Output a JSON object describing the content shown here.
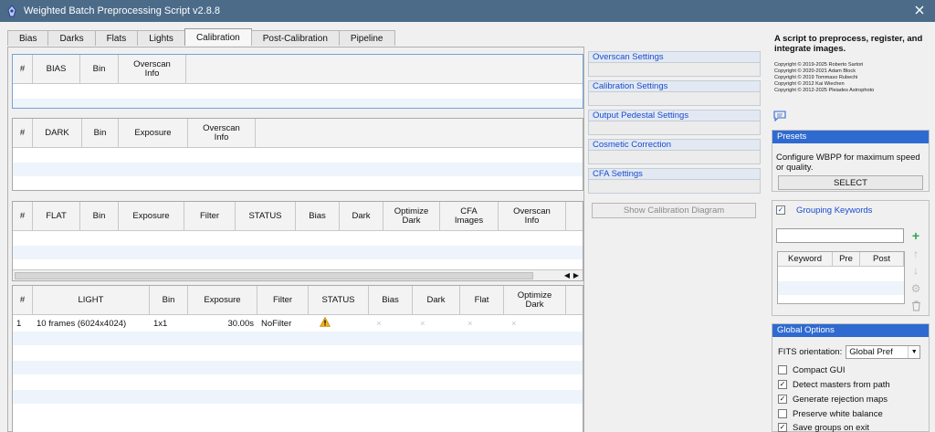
{
  "window": {
    "title": "Weighted Batch Preprocessing Script v2.8.8"
  },
  "tabs": [
    "Bias",
    "Darks",
    "Flats",
    "Lights",
    "Calibration",
    "Post-Calibration",
    "Pipeline"
  ],
  "active_tab": "Calibration",
  "bias_table": {
    "headers": [
      "#",
      "BIAS",
      "Bin",
      "Overscan\nInfo"
    ]
  },
  "dark_table": {
    "headers": [
      "#",
      "DARK",
      "Bin",
      "Exposure",
      "Overscan\nInfo"
    ]
  },
  "flat_table": {
    "headers": [
      "#",
      "FLAT",
      "Bin",
      "Exposure",
      "Filter",
      "STATUS",
      "Bias",
      "Dark",
      "Optimize\nDark",
      "CFA\nImages",
      "Overscan\nInfo"
    ]
  },
  "light_table": {
    "headers": [
      "#",
      "LIGHT",
      "Bin",
      "Exposure",
      "Filter",
      "STATUS",
      "Bias",
      "Dark",
      "Flat",
      "Optimize\nDark"
    ],
    "rows": [
      {
        "num": "1",
        "name": "10 frames (6024x4024)",
        "bin": "1x1",
        "exposure": "30.00s",
        "filter": "NoFilter",
        "status": "warning",
        "bias": "×",
        "dark": "×",
        "flat": "×",
        "optimize": "×"
      }
    ]
  },
  "settings_sections": [
    "Overscan Settings",
    "Calibration Settings",
    "Output Pedestal Settings",
    "Cosmetic Correction",
    "CFA Settings"
  ],
  "diagram_button": "Show Calibration Diagram",
  "description": "A script to preprocess, register, and integrate images.",
  "copyright": [
    "Copyright © 2019-2025 Roberto Sartori",
    "Copyright © 2020-2021 Adam Block",
    "Copyright © 2019 Tommaso Rubechi",
    "Copyright © 2012 Kai Wiechen",
    "Copyright © 2012-2025 Pleiades Astrophoto"
  ],
  "presets": {
    "title": "Presets",
    "text": "Configure WBPP for maximum speed or quality.",
    "button": "SELECT"
  },
  "grouping": {
    "title": "Grouping Keywords",
    "checked": true,
    "headers": [
      "Keyword",
      "Pre",
      "Post"
    ]
  },
  "global_options": {
    "title": "Global Options",
    "fits_label": "FITS orientation:",
    "fits_value": "Global Pref",
    "options": [
      {
        "label": "Compact GUI",
        "checked": false
      },
      {
        "label": "Detect masters from path",
        "checked": true
      },
      {
        "label": "Generate rejection maps",
        "checked": true
      },
      {
        "label": "Preserve white balance",
        "checked": false
      },
      {
        "label": "Save groups on exit",
        "checked": true
      }
    ]
  },
  "colors": {
    "titlebar": "#4b6b89",
    "accent": "#2f6ad0",
    "link": "#1a4bd0"
  }
}
